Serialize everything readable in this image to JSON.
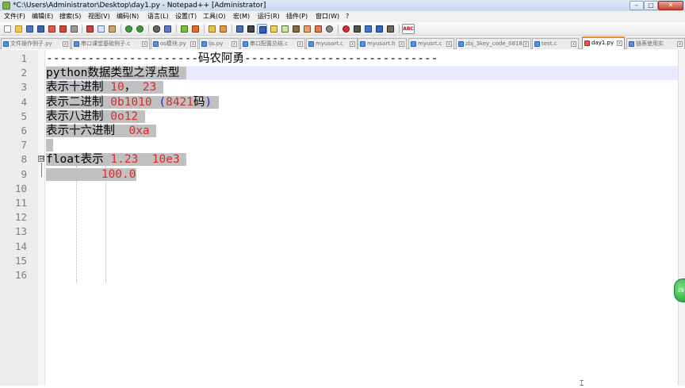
{
  "window": {
    "title": "*C:\\Users\\Administrator\\Desktop\\day1.py - Notepad++ [Administrator]"
  },
  "window_buttons": {
    "minimize": "–",
    "maximize": "□",
    "close": "✕"
  },
  "menu": [
    "文件(F)",
    "编辑(E)",
    "搜索(S)",
    "视图(V)",
    "编码(N)",
    "语言(L)",
    "设置(T)",
    "工具(O)",
    "宏(M)",
    "运行(R)",
    "插件(P)",
    "窗口(W)",
    "?"
  ],
  "toolbar": {
    "spellcheck_label": "ABC"
  },
  "tabs": [
    "文件操作例子.py",
    "串口课堂基础例子.c",
    "os模块.py",
    "ljs.py",
    "串口配置总结.c",
    "myusart.c",
    "myusart.h",
    "myusrt.c",
    "zbj_3key_code_0818.c",
    "test.c",
    "day1.py",
    "链表使用实"
  ],
  "tab_close_glyph": "x",
  "active_tab_index": 10,
  "editor": {
    "line_numbers": [
      "1",
      "2",
      "3",
      "4",
      "5",
      "6",
      "7",
      "8",
      "9",
      "10",
      "11",
      "12",
      "13",
      "14",
      "15",
      "16"
    ],
    "lines": [
      {
        "segments": [
          {
            "t": "----------------------码农阿勇----------------------------",
            "c": "plain"
          }
        ]
      },
      {
        "segments": [
          {
            "t": "python数据类型之浮点型 ",
            "c": "sel"
          }
        ]
      },
      {
        "segments": [
          {
            "t": "表示十进制 ",
            "c": "sel"
          },
          {
            "t": "10",
            "c": "sel red"
          },
          {
            "t": "，",
            "c": "sel"
          },
          {
            "t": " 23",
            "c": "sel red"
          },
          {
            "t": " ",
            "c": "sel"
          }
        ]
      },
      {
        "segments": [
          {
            "t": "表示二进制 ",
            "c": "sel"
          },
          {
            "t": "0b1010",
            "c": "sel red"
          },
          {
            "t": " (",
            "c": "sel blue"
          },
          {
            "t": "8421",
            "c": "sel red"
          },
          {
            "t": "码",
            "c": "sel"
          },
          {
            "t": ")",
            "c": "sel blue"
          },
          {
            "t": " ",
            "c": "sel"
          }
        ]
      },
      {
        "segments": [
          {
            "t": "表示八进制 ",
            "c": "sel"
          },
          {
            "t": "0o12",
            "c": "sel red"
          },
          {
            "t": " ",
            "c": "sel"
          }
        ]
      },
      {
        "segments": [
          {
            "t": "表示十六进制  ",
            "c": "sel"
          },
          {
            "t": "0xa",
            "c": "sel red"
          },
          {
            "t": " ",
            "c": "sel"
          }
        ]
      },
      {
        "segments": [
          {
            "t": " ",
            "c": "sel"
          }
        ]
      },
      {
        "segments": [
          {
            "t": "float表示 ",
            "c": "sel"
          },
          {
            "t": "1.23",
            "c": "sel red"
          },
          {
            "t": "  ",
            "c": "sel"
          },
          {
            "t": "10e3",
            "c": "sel red"
          },
          {
            "t": " ",
            "c": "sel"
          }
        ]
      },
      {
        "segments": [
          {
            "t": "        ",
            "c": "sel"
          },
          {
            "t": "100.0",
            "c": "sel red"
          }
        ]
      },
      {
        "segments": []
      },
      {
        "segments": []
      },
      {
        "segments": []
      },
      {
        "segments": []
      },
      {
        "segments": []
      },
      {
        "segments": []
      },
      {
        "segments": []
      }
    ]
  },
  "fold_marker": "⊟",
  "side_badge": "29"
}
